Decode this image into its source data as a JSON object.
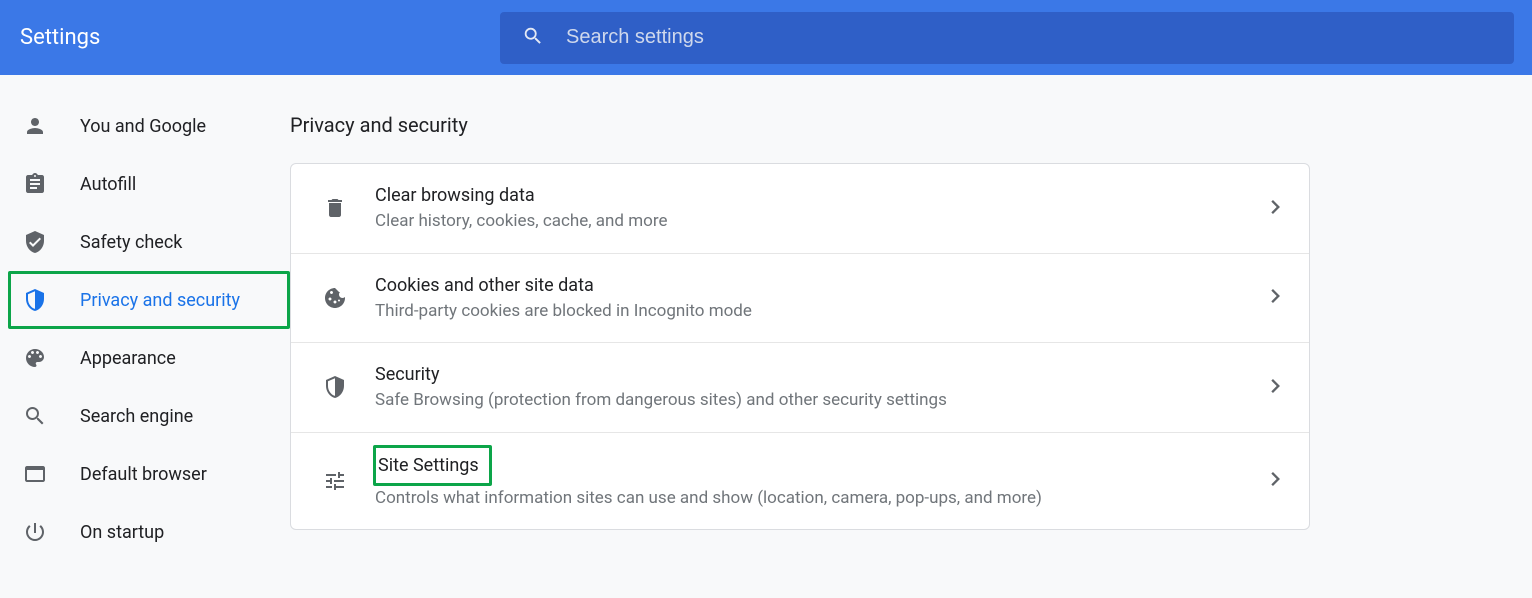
{
  "header": {
    "title": "Settings",
    "search_placeholder": "Search settings"
  },
  "sidebar": {
    "items": [
      {
        "id": "you-and-google",
        "label": "You and Google"
      },
      {
        "id": "autofill",
        "label": "Autofill"
      },
      {
        "id": "safety-check",
        "label": "Safety check"
      },
      {
        "id": "privacy-and-security",
        "label": "Privacy and security",
        "active": true,
        "highlighted": true
      },
      {
        "id": "appearance",
        "label": "Appearance"
      },
      {
        "id": "search-engine",
        "label": "Search engine"
      },
      {
        "id": "default-browser",
        "label": "Default browser"
      },
      {
        "id": "on-startup",
        "label": "On startup"
      }
    ]
  },
  "main": {
    "section_title": "Privacy and security",
    "rows": [
      {
        "id": "clear-browsing-data",
        "title": "Clear browsing data",
        "subtitle": "Clear history, cookies, cache, and more"
      },
      {
        "id": "cookies",
        "title": "Cookies and other site data",
        "subtitle": "Third-party cookies are blocked in Incognito mode"
      },
      {
        "id": "security",
        "title": "Security",
        "subtitle": "Safe Browsing (protection from dangerous sites) and other security settings"
      },
      {
        "id": "site-settings",
        "title": "Site Settings",
        "subtitle": "Controls what information sites can use and show (location, camera, pop-ups, and more)",
        "highlighted": true
      }
    ]
  }
}
